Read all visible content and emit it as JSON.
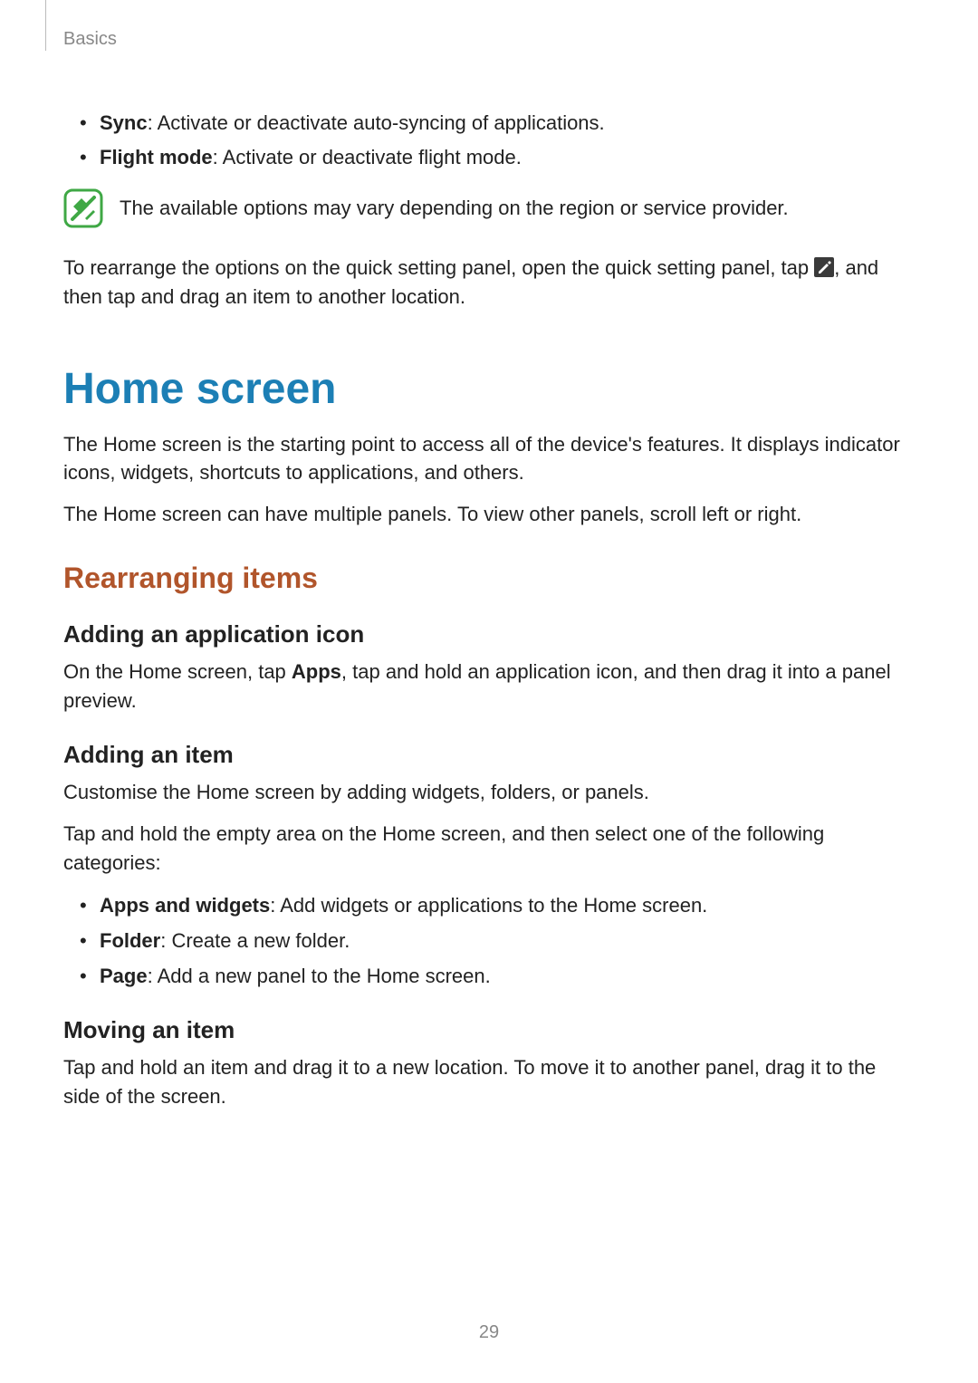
{
  "header": {
    "section": "Basics"
  },
  "top_bullets": [
    {
      "term": "Sync",
      "desc": ": Activate or deactivate auto-syncing of applications."
    },
    {
      "term": "Flight mode",
      "desc": ": Activate or deactivate flight mode."
    }
  ],
  "note": {
    "text": "The available options may vary depending on the region or service provider."
  },
  "rearrange_panel": {
    "before": "To rearrange the options on the quick setting panel, open the quick setting panel, tap ",
    "after": ", and then tap and drag an item to another location."
  },
  "home_screen": {
    "title": "Home screen",
    "intro1": "The Home screen is the starting point to access all of the device's features. It displays indicator icons, widgets, shortcuts to applications, and others.",
    "intro2": "The Home screen can have multiple panels. To view other panels, scroll left or right.",
    "rearranging": {
      "title": "Rearranging items",
      "adding_app_icon": {
        "title": "Adding an application icon",
        "text_before": "On the Home screen, tap ",
        "apps_label": "Apps",
        "text_after": ", tap and hold an application icon, and then drag it into a panel preview."
      },
      "adding_item": {
        "title": "Adding an item",
        "p1": "Customise the Home screen by adding widgets, folders, or panels.",
        "p2": "Tap and hold the empty area on the Home screen, and then select one of the following categories:",
        "bullets": [
          {
            "term": "Apps and widgets",
            "desc": ": Add widgets or applications to the Home screen."
          },
          {
            "term": "Folder",
            "desc": ": Create a new folder."
          },
          {
            "term": "Page",
            "desc": ": Add a new panel to the Home screen."
          }
        ]
      },
      "moving_item": {
        "title": "Moving an item",
        "text": "Tap and hold an item and drag it to a new location. To move it to another panel, drag it to the side of the screen."
      }
    }
  },
  "page_number": "29"
}
